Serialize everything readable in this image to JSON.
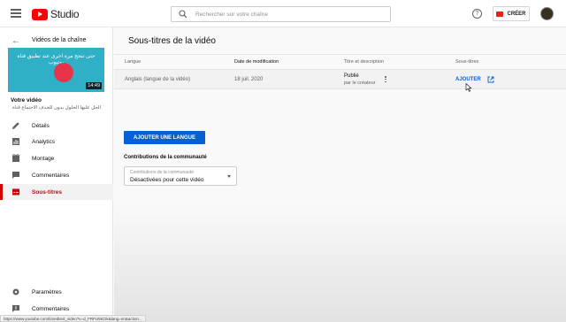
{
  "header": {
    "app_name": "Studio",
    "search_placeholder": "Rechercher sur votre chaîne",
    "help_symbol": "?",
    "create_label": "CRÉER"
  },
  "sidebar": {
    "back_label": "Vidéos de la chaîne",
    "thumbnail_title": "حتى تنجح مرة اخرى عند تطبيق قناة يوتيوب",
    "thumbnail_duration": "14:49",
    "your_video_label": "Votre vidéo",
    "video_name": "الحل عليها الحلول بدون للحذف الاجتماع قناة يوتيوب ؟",
    "items": [
      {
        "label": "Détails",
        "icon": "pencil-icon"
      },
      {
        "label": "Analytics",
        "icon": "bar-chart-icon"
      },
      {
        "label": "Montage",
        "icon": "film-icon"
      },
      {
        "label": "Commentaires",
        "icon": "comment-icon"
      },
      {
        "label": "Sous-titres",
        "icon": "subtitles-icon",
        "active": true
      }
    ],
    "settings_label": "Paramètres",
    "feedback_label": "Commentaires"
  },
  "main": {
    "title": "Sous-titres de la vidéo",
    "columns": [
      "Langue",
      "Date de modification",
      "Titre et description",
      "Sous-titres"
    ],
    "row": {
      "language": "Anglais (langue de la vidéo)",
      "date": "18 juil. 2020",
      "status": "Publié",
      "status_sub": "par le créateur",
      "add_label": "AJOUTER"
    },
    "add_language_label": "AJOUTER UNE LANGUE",
    "contrib_title": "Contributions de la communauté",
    "contrib_select_label": "Contributions de la communauté",
    "contrib_select_value": "Désactivées pour cette vidéo"
  },
  "status_bar_url": "https://www.youtube.com/timedtext_video?v=d_FRFU5kCIk&lang=en&action...",
  "colors": {
    "accent_blue": "#065fd4",
    "brand_red": "#ff0000",
    "active_red": "#cc0000"
  }
}
